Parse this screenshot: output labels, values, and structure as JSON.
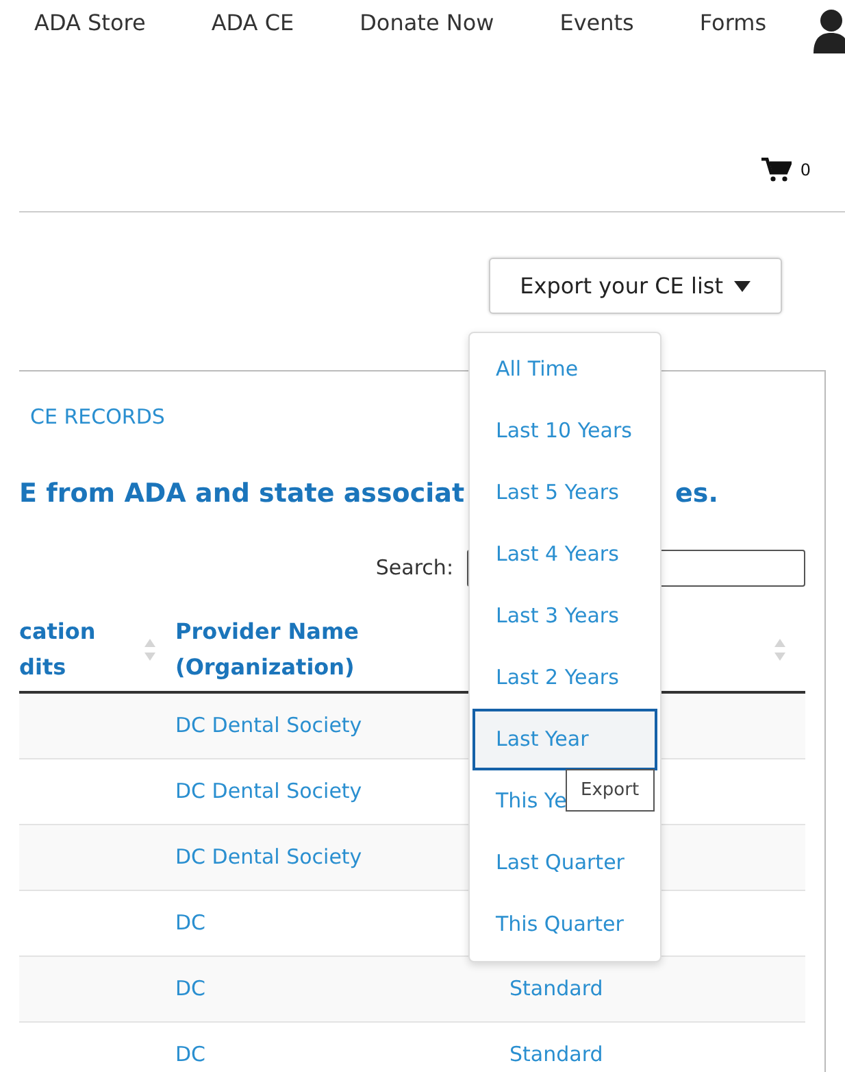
{
  "nav": {
    "items": [
      "ADA Store",
      "ADA CE",
      "Donate Now",
      "Events",
      "Forms"
    ]
  },
  "cart": {
    "count": "0"
  },
  "export_button": {
    "label": "Export your CE list",
    "expanded": true
  },
  "export_menu": {
    "items": [
      {
        "label": "All Time",
        "selected": false
      },
      {
        "label": "Last 10 Years",
        "selected": false
      },
      {
        "label": "Last 5 Years",
        "selected": false
      },
      {
        "label": "Last 4 Years",
        "selected": false
      },
      {
        "label": "Last 3 Years",
        "selected": false
      },
      {
        "label": "Last 2 Years",
        "selected": false
      },
      {
        "label": "Last Year",
        "selected": true
      },
      {
        "label": "This Ye",
        "selected": false
      },
      {
        "label": "Last Quarter",
        "selected": false
      },
      {
        "label": "This Quarter",
        "selected": false
      }
    ]
  },
  "tooltip": "Export",
  "section_link": "CE RECORDS",
  "heading": {
    "before": "E from ADA and state associat",
    "after": "es."
  },
  "search": {
    "label": "Search:"
  },
  "table": {
    "columns": [
      {
        "label": "cation\ndits"
      },
      {
        "label": "Provider Name\n(Organization)"
      }
    ],
    "rows": [
      {
        "provider": "DC Dental Society"
      },
      {
        "provider": "DC Dental Society"
      },
      {
        "provider": "DC Dental Society"
      },
      {
        "provider": "DC"
      },
      {
        "provider": "DC",
        "type": "Standard"
      },
      {
        "provider": "DC",
        "type": "Standard"
      }
    ]
  }
}
